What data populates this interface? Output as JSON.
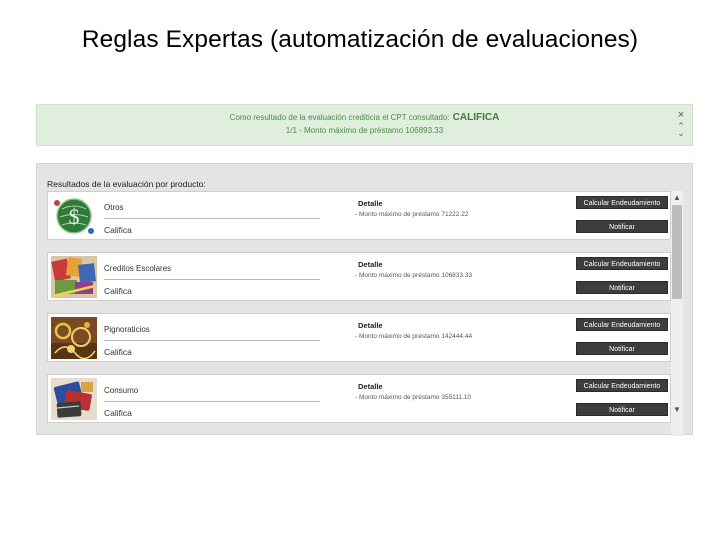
{
  "title": "Reglas Expertas (automatización de evaluaciones)",
  "banner": {
    "message": "Como resultado de la evaluación crediticia el CPT consultado:",
    "result": "CALIFICA",
    "detail": "1/1 - Monto máximo de préstamo 106893.33",
    "close_icon": "×",
    "scroll_up_icon": "⌃",
    "scroll_down_icon": "⌄"
  },
  "results": {
    "heading": "Resultados de la evaluación por producto:",
    "detail_label": "Detalle",
    "calc_button_label": "Calcular Endeudamiento",
    "notify_button_label": "Notificar",
    "products": [
      {
        "name": "Otros",
        "status": "Califica",
        "detail": "- Monto máximo de préstamo 71222.22",
        "image_icon": "dollar-globe-image"
      },
      {
        "name": "Creditos Escolares",
        "status": "Califica",
        "detail": "- Monto máximo de préstamo 106833.33",
        "image_icon": "school-supplies-image"
      },
      {
        "name": "Pignoraticios",
        "status": "Califica",
        "detail": "- Monto máximo de préstamo 142444.44",
        "image_icon": "jewelry-image"
      },
      {
        "name": "Consumo",
        "status": "Califica",
        "detail": "- Monto máximo de préstamo 355111.10",
        "image_icon": "shopping-cards-image"
      }
    ],
    "scrollbar": {
      "up_icon": "▲",
      "down_icon": "▼"
    }
  }
}
